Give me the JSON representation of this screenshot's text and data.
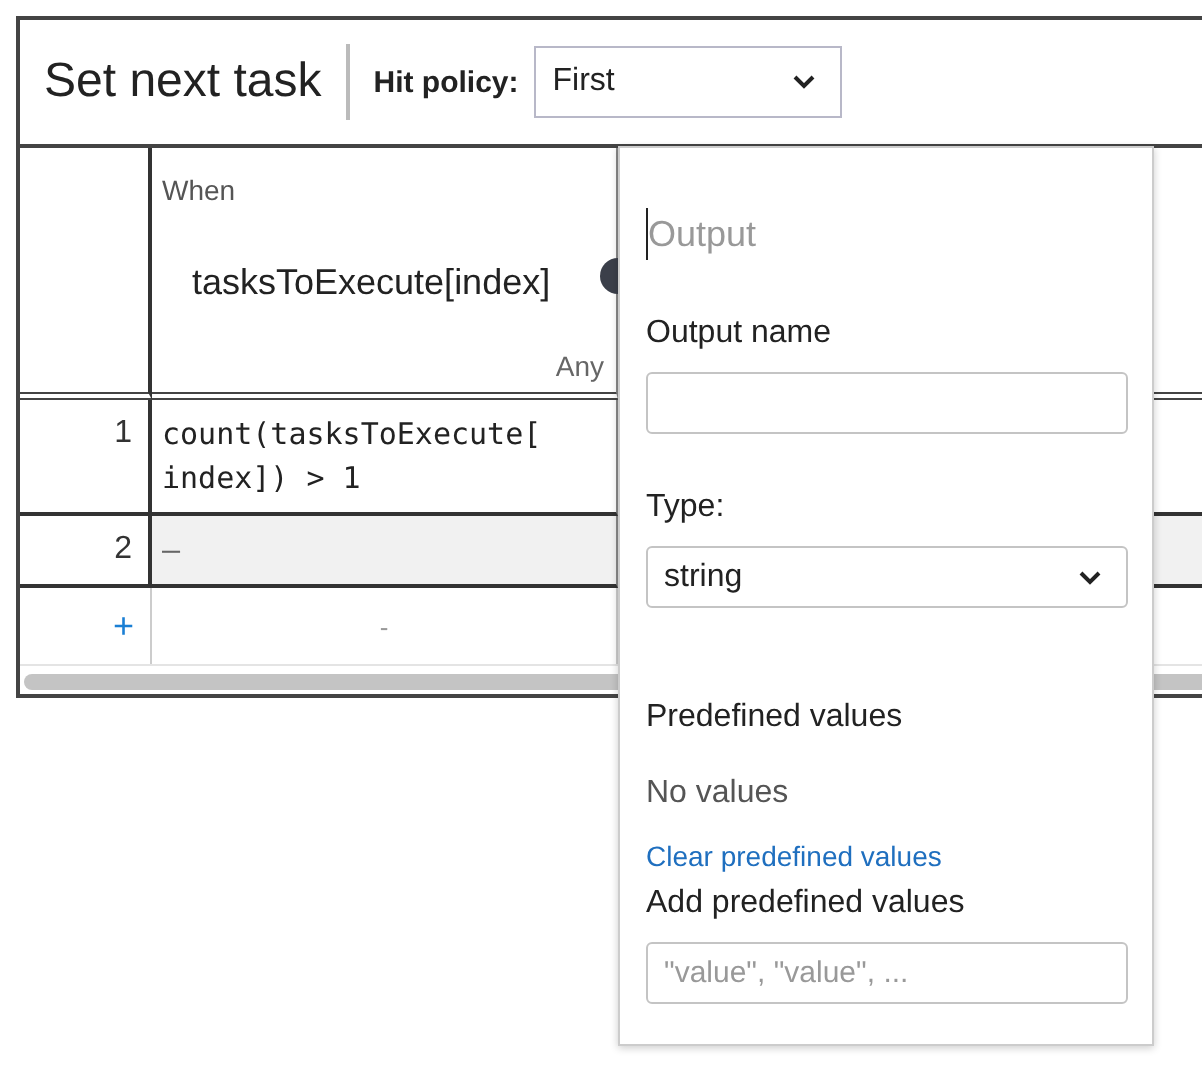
{
  "header": {
    "title": "Set next task",
    "hit_policy_label": "Hit policy:",
    "hit_policy": "First"
  },
  "input_column": {
    "label": "When",
    "expression": "tasksToExecute[index]",
    "type": "Any"
  },
  "rows": [
    {
      "index": "1",
      "cell": "count(tasksToExecute[\nindex]) > 1",
      "selected": false
    },
    {
      "index": "2",
      "cell": "–",
      "selected": true
    }
  ],
  "add_row": {
    "symbol": "+",
    "cell": "-"
  },
  "popover": {
    "name_placeholder": "Output",
    "output_name_label": "Output name",
    "type_label": "Type:",
    "type": "string",
    "predefined_title": "Predefined values",
    "no_values": "No values",
    "clear_link": "Clear predefined values",
    "add_label": "Add predefined values",
    "add_placeholder": "\"value\", \"value\", ..."
  }
}
